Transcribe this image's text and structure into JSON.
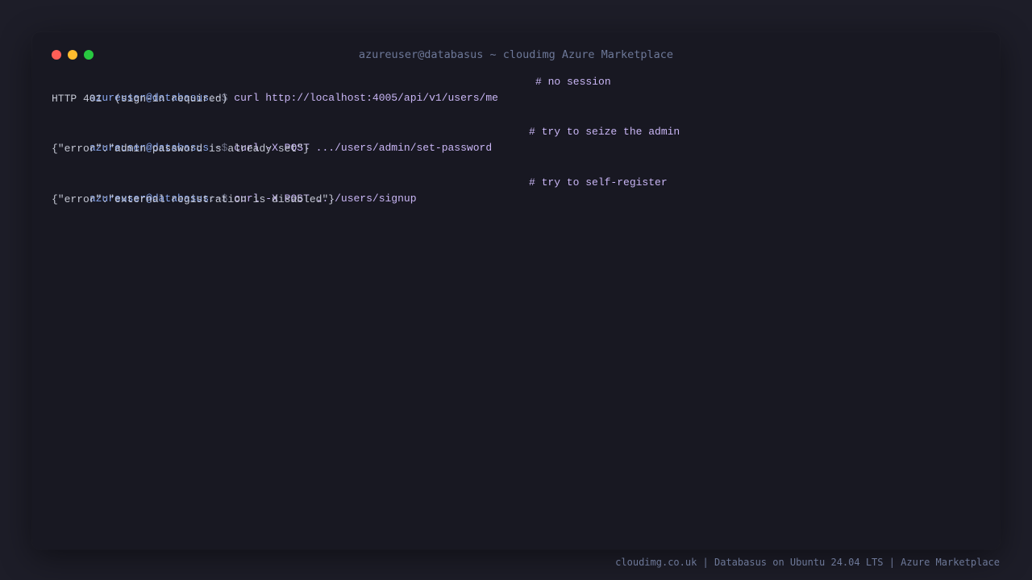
{
  "window": {
    "title": "azureuser@databasus ~ cloudimg Azure Marketplace"
  },
  "terminal": {
    "lines": [
      {
        "prompt_user": "azureuser@databasus",
        "prompt_path": ":~$",
        "command": "curl http://localhost:4005/api/v1/users/me",
        "comment": "# no session",
        "output": "HTTP 401  (sign-in required)"
      },
      {
        "prompt_user": "azureuser@databasus",
        "prompt_path": ":~$",
        "command": "curl -X POST .../users/admin/set-password",
        "comment": "# try to seize the admin",
        "output": "{\"error\":\"admin password is already set\"}"
      },
      {
        "prompt_user": "azureuser@databasus",
        "prompt_path": ":~$",
        "command": "curl -X POST .../users/signup",
        "comment": "# try to self-register",
        "output": "{\"error\":\"external registration is disabled\"}"
      }
    ]
  },
  "footer": {
    "text": "cloudimg.co.uk | Databasus on Ubuntu 24.04 LTS | Azure Marketplace"
  },
  "colors": {
    "background": "#1d1d28",
    "terminal_bg": "#181822",
    "prompt_user": "#8aa8f0",
    "command": "#c9b6f5",
    "output": "#c4c7d4",
    "close_button": "#ff5f57",
    "minimize_button": "#febc2e",
    "maximize_button": "#28c840"
  }
}
